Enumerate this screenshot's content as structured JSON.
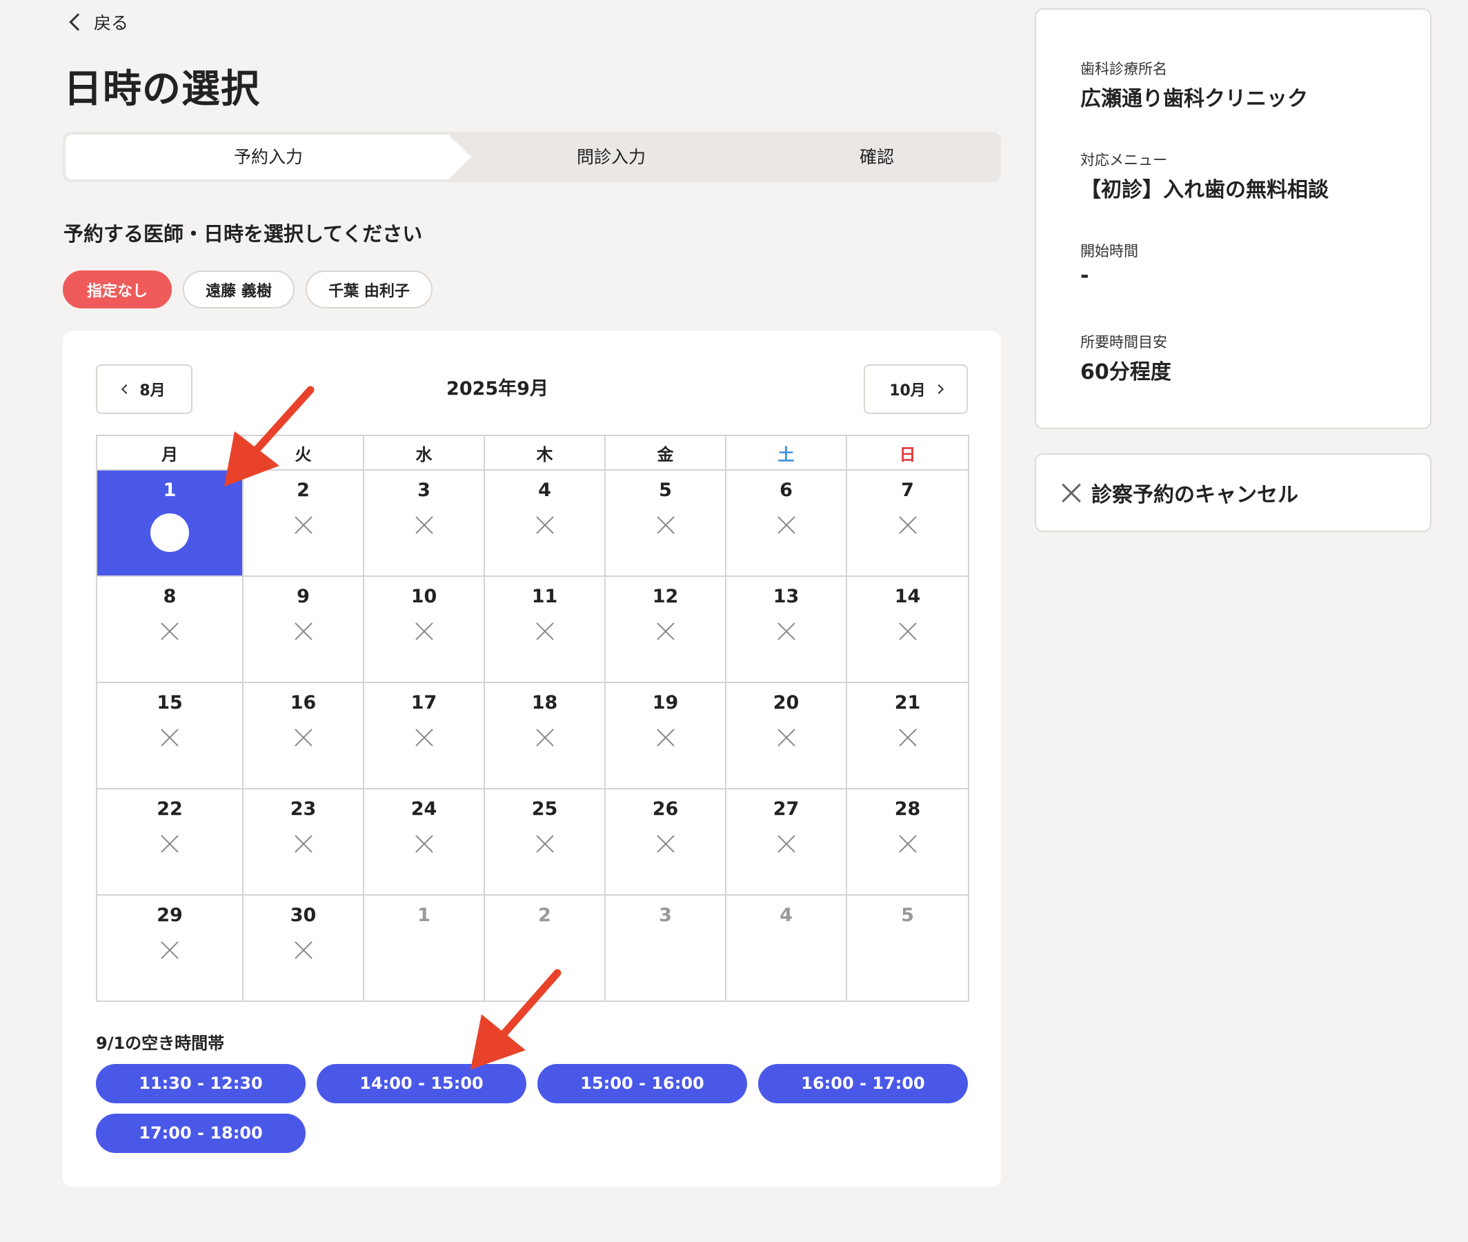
{
  "nav": {
    "back_label": "戻る"
  },
  "page": {
    "title": "日時の選択",
    "subtitle": "予約する医師・日時を選択してください"
  },
  "steps": [
    {
      "label": "予約入力",
      "active": true
    },
    {
      "label": "問診入力",
      "active": false
    },
    {
      "label": "確認",
      "active": false
    }
  ],
  "doctors": [
    {
      "label": "指定なし",
      "selected": true
    },
    {
      "label": "遠藤 義樹",
      "selected": false
    },
    {
      "label": "千葉 由利子",
      "selected": false
    }
  ],
  "calendar": {
    "prev_label": "8月",
    "next_label": "10月",
    "title": "2025年9月",
    "weekdays": [
      "月",
      "火",
      "水",
      "木",
      "金",
      "土",
      "日"
    ],
    "weekday_colors": {
      "sat": "#3b8fdc",
      "sun": "#e0383a"
    },
    "selected_color": "#4a58e8",
    "weeks": [
      [
        {
          "d": "1",
          "s": "o",
          "sel": true
        },
        {
          "d": "2",
          "s": "x"
        },
        {
          "d": "3",
          "s": "x"
        },
        {
          "d": "4",
          "s": "x"
        },
        {
          "d": "5",
          "s": "x"
        },
        {
          "d": "6",
          "s": "x"
        },
        {
          "d": "7",
          "s": "x"
        }
      ],
      [
        {
          "d": "8",
          "s": "x"
        },
        {
          "d": "9",
          "s": "x"
        },
        {
          "d": "10",
          "s": "x"
        },
        {
          "d": "11",
          "s": "x"
        },
        {
          "d": "12",
          "s": "x"
        },
        {
          "d": "13",
          "s": "x"
        },
        {
          "d": "14",
          "s": "x"
        }
      ],
      [
        {
          "d": "15",
          "s": "x"
        },
        {
          "d": "16",
          "s": "x"
        },
        {
          "d": "17",
          "s": "x"
        },
        {
          "d": "18",
          "s": "x"
        },
        {
          "d": "19",
          "s": "x"
        },
        {
          "d": "20",
          "s": "x"
        },
        {
          "d": "21",
          "s": "x"
        }
      ],
      [
        {
          "d": "22",
          "s": "x"
        },
        {
          "d": "23",
          "s": "x"
        },
        {
          "d": "24",
          "s": "x"
        },
        {
          "d": "25",
          "s": "x"
        },
        {
          "d": "26",
          "s": "x"
        },
        {
          "d": "27",
          "s": "x"
        },
        {
          "d": "28",
          "s": "x"
        }
      ],
      [
        {
          "d": "29",
          "s": "x"
        },
        {
          "d": "30",
          "s": "x"
        },
        {
          "d": "1",
          "s": "",
          "muted": true
        },
        {
          "d": "2",
          "s": "",
          "muted": true
        },
        {
          "d": "3",
          "s": "",
          "muted": true
        },
        {
          "d": "4",
          "s": "",
          "muted": true
        },
        {
          "d": "5",
          "s": "",
          "muted": true
        }
      ]
    ]
  },
  "slots": {
    "title": "9/1の空き時間帯",
    "items": [
      "11:30 - 12:30",
      "14:00 - 15:00",
      "15:00 - 16:00",
      "16:00 - 17:00",
      "17:00 - 18:00"
    ]
  },
  "summary": {
    "clinic_label": "歯科診療所名",
    "clinic_value": "広瀬通り歯科クリニック",
    "menu_label": "対応メニュー",
    "menu_value": "【初診】入れ歯の無料相談",
    "start_label": "開始時間",
    "start_value": "-",
    "duration_label": "所要時間目安",
    "duration_value": "60分程度"
  },
  "cancel": {
    "label": "診察予約のキャンセル"
  },
  "annotation_color": "#e8432a"
}
